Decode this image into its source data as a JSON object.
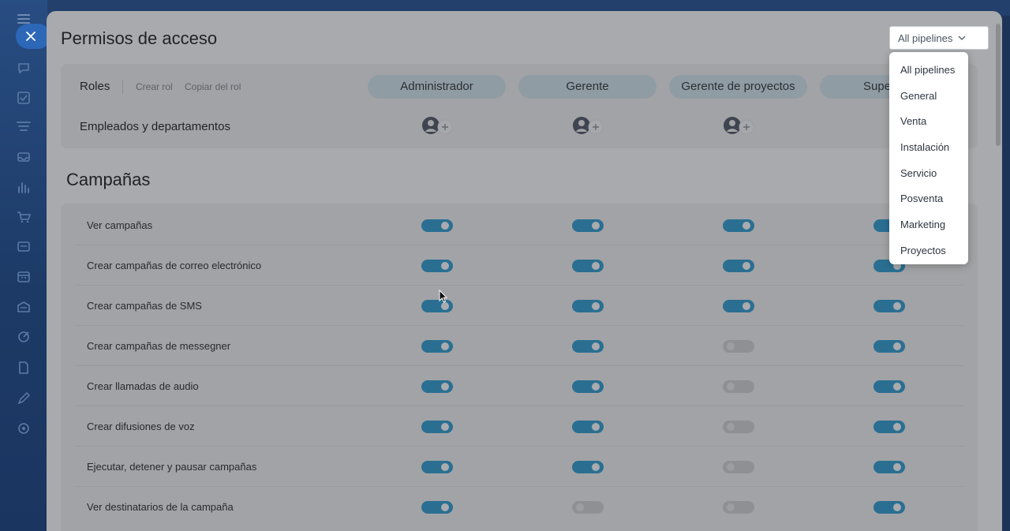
{
  "app": {
    "sidebar_icons": [
      "menu-icon",
      "chat-icon",
      "tasks-icon",
      "crm-icon",
      "inbox-icon",
      "analytics-icon",
      "shop-icon",
      "sites-icon",
      "calendar-icon",
      "warehouse-icon",
      "marketing-icon",
      "documents-icon",
      "sign-icon",
      "settings-icon"
    ]
  },
  "header": {
    "title": "Permisos de acceso",
    "pipeline_select": "All pipelines"
  },
  "pipeline_dropdown": {
    "options": [
      "All pipelines",
      "General",
      "Venta",
      "Instalación",
      "Servicio",
      "Posventa",
      "Marketing",
      "Proyectos"
    ]
  },
  "roles": {
    "label": "Roles",
    "create_link": "Crear rol",
    "copy_link": "Copiar del rol",
    "columns": [
      "Administrador",
      "Gerente",
      "Gerente de proyectos",
      "Supervisor"
    ],
    "employees_label": "Empleados y departamentos"
  },
  "section": {
    "title": "Campañas"
  },
  "permissions": [
    {
      "label": "Ver campañas",
      "values": [
        true,
        true,
        true,
        true
      ]
    },
    {
      "label": "Crear campañas de correo electrónico",
      "values": [
        true,
        true,
        true,
        true
      ]
    },
    {
      "label": "Crear campañas de SMS",
      "values": [
        true,
        true,
        true,
        true
      ]
    },
    {
      "label": "Crear campañas de messegner",
      "values": [
        true,
        true,
        false,
        true
      ]
    },
    {
      "label": "Crear llamadas de audio",
      "values": [
        true,
        true,
        false,
        true
      ]
    },
    {
      "label": "Crear difusiones de voz",
      "values": [
        true,
        true,
        false,
        true
      ]
    },
    {
      "label": "Ejecutar, detener y pausar campañas",
      "values": [
        true,
        true,
        false,
        true
      ]
    },
    {
      "label": "Ver destinatarios de la campaña",
      "values": [
        true,
        false,
        false,
        true
      ]
    }
  ],
  "colors": {
    "toggle_on": "#2a6f92",
    "toggle_off": "#8e9094",
    "overlay_panel": "#a8aaad",
    "app_sidebar": "#23406c"
  }
}
